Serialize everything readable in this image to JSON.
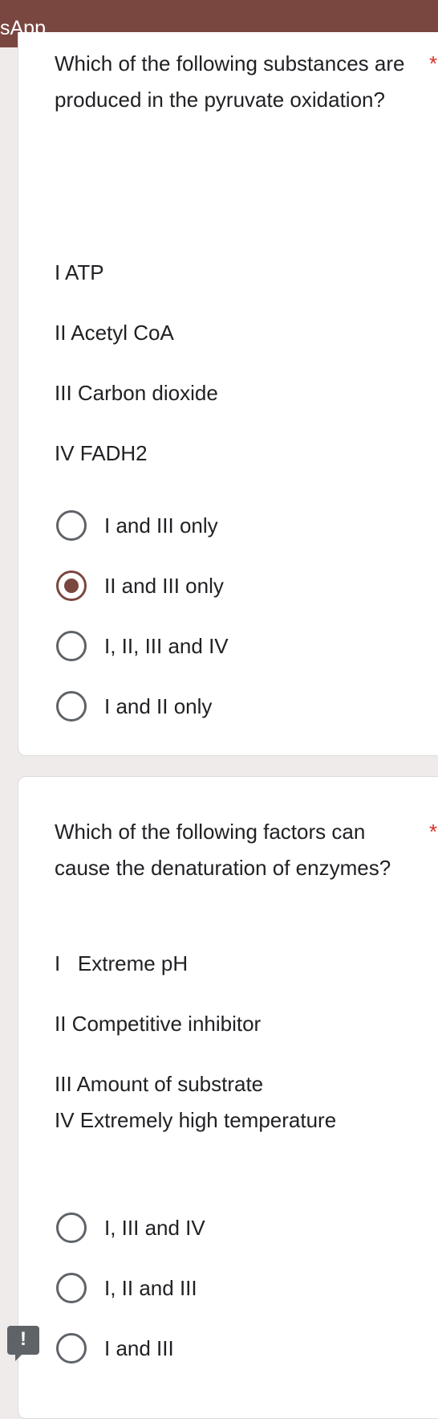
{
  "app": {
    "title_fragment": "sApp",
    "header_color": "#7a4640",
    "accent_color": "#7a4640",
    "required_color": "#d93025"
  },
  "questions": [
    {
      "title": "Which of the following substances are produced in the pyruvate oxidation?",
      "required_mark": "*",
      "statements": [
        "I ATP",
        "II Acetyl CoA",
        "III Carbon dioxide",
        "IV FADH2"
      ],
      "options": [
        {
          "label": "I and III only",
          "selected": false
        },
        {
          "label": "II and III only",
          "selected": true
        },
        {
          "label": "I, II, III and IV",
          "selected": false
        },
        {
          "label": "I and II only",
          "selected": false
        }
      ]
    },
    {
      "title": "Which of the following factors can cause the denaturation of enzymes?",
      "required_mark": "*",
      "statements": [
        "I   Extreme pH",
        "II Competitive inhibitor",
        "III Amount of substrate",
        "IV Extremely high temperature"
      ],
      "options": [
        {
          "label": "I, III and IV",
          "selected": false
        },
        {
          "label": "I, II and III",
          "selected": false
        },
        {
          "label": "I and III",
          "selected": false
        }
      ]
    }
  ],
  "feedback": {
    "icon": "feedback-icon",
    "glyph": "!"
  }
}
